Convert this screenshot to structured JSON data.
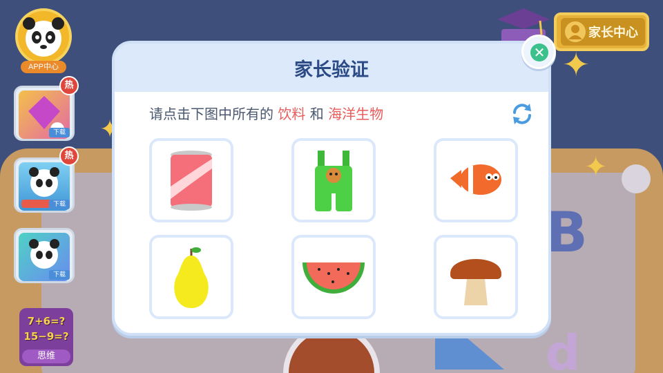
{
  "sidebar": {
    "app_center_label": "APP中心",
    "apps": [
      {
        "badge": "热",
        "download": "下载"
      },
      {
        "badge": "热",
        "download": "下载",
        "brand": "BabyBus"
      },
      {
        "download": "下载"
      }
    ],
    "math_tile": {
      "line1": "7+6=?",
      "line2": "15−9=?",
      "label": "思维"
    }
  },
  "header": {
    "parent_center_label": "家长中心"
  },
  "modal": {
    "title": "家长验证",
    "instruction_prefix": "请点击下图中所有的",
    "category_1": "饮料",
    "conjunction": "和",
    "category_2": "海洋生物",
    "items": [
      {
        "icon": "soda-can-icon"
      },
      {
        "icon": "overalls-icon"
      },
      {
        "icon": "clownfish-icon"
      },
      {
        "icon": "pear-icon"
      },
      {
        "icon": "watermelon-icon"
      },
      {
        "icon": "mushroom-icon"
      }
    ]
  },
  "colors": {
    "accent_text": "#ea5b5b",
    "title_text": "#2c4a86",
    "close_green": "#3cc18c",
    "refresh_blue": "#4a9be0"
  }
}
